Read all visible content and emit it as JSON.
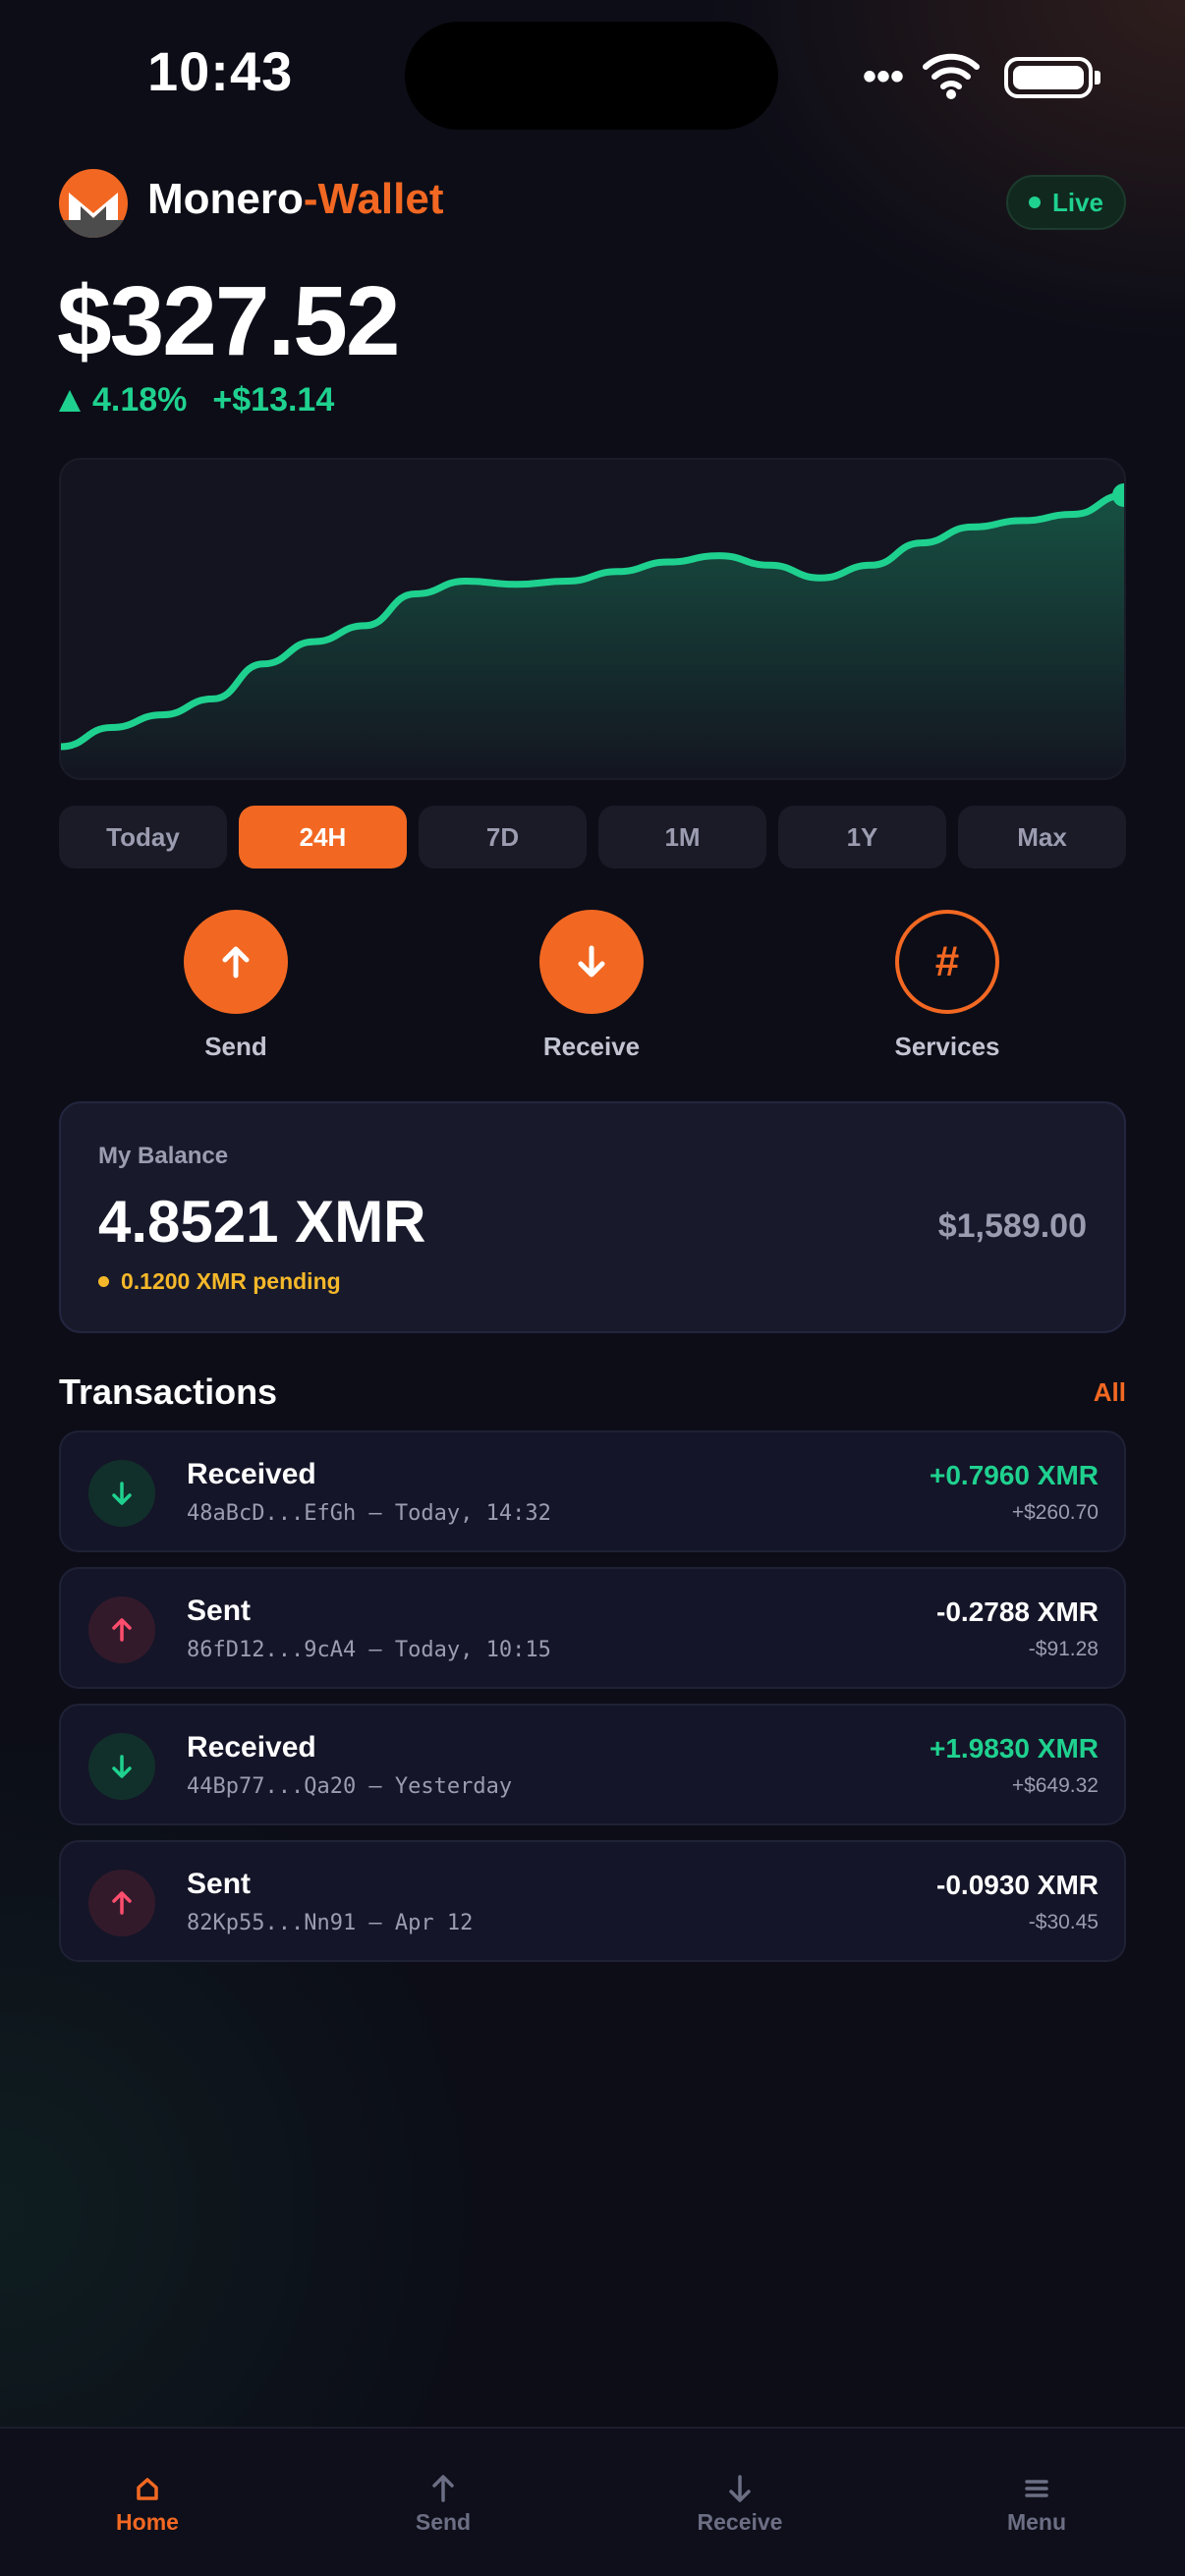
{
  "status_bar": {
    "time": "10:43",
    "more": "•••"
  },
  "header": {
    "title_main": "Monero",
    "title_accent": "-Wallet",
    "live_badge": "Live",
    "logo_icon": "monero-logo-icon"
  },
  "price": {
    "value": "$327.52",
    "change_pct": "4.18%",
    "change_abs": "+$13.14"
  },
  "chart_data": {
    "type": "area",
    "color": "#1fd18f",
    "values": [
      0,
      6,
      10,
      15,
      26,
      33,
      38,
      48,
      52,
      51,
      52,
      55,
      58,
      60,
      57,
      53,
      57,
      64,
      69,
      71,
      73,
      79
    ]
  },
  "timeframes": [
    {
      "label": "Today"
    },
    {
      "label": "24H",
      "active": true
    },
    {
      "label": "7D"
    },
    {
      "label": "1M"
    },
    {
      "label": "1Y"
    },
    {
      "label": "Max"
    }
  ],
  "actions": {
    "send_label": "Send",
    "receive_label": "Receive",
    "services_label": "Services",
    "services_symbol": "#"
  },
  "balance": {
    "label": "My Balance",
    "amount": "4.8521 XMR",
    "pending": "0.1200 XMR pending",
    "usd": "$1,589.00"
  },
  "transactions": {
    "title": "Transactions",
    "all_label": "All",
    "items": [
      {
        "kind": "Received",
        "sub": "48aBcD...EfGh – Today, 14:32",
        "amount": "+0.7960 XMR",
        "usd": "+$260.70",
        "direction": "in"
      },
      {
        "kind": "Sent",
        "sub": "86fD12...9cA4 – Today, 10:15",
        "amount": "-0.2788 XMR",
        "usd": "-$91.28",
        "direction": "out"
      },
      {
        "kind": "Received",
        "sub": "44Bp77...Qa20 – Yesterday",
        "amount": "+1.9830 XMR",
        "usd": "+$649.32",
        "direction": "in"
      },
      {
        "kind": "Sent",
        "sub": "82Kp55...Nn91 – Apr 12",
        "amount": "-0.0930 XMR",
        "usd": "-$30.45",
        "direction": "out"
      }
    ]
  },
  "nav": {
    "home": "Home",
    "send": "Send",
    "receive": "Receive",
    "menu": "Menu"
  },
  "colors": {
    "accent": "#f26822",
    "positive": "#1fd18f",
    "negative": "#ff4d6d",
    "pending": "#f5b82a"
  }
}
